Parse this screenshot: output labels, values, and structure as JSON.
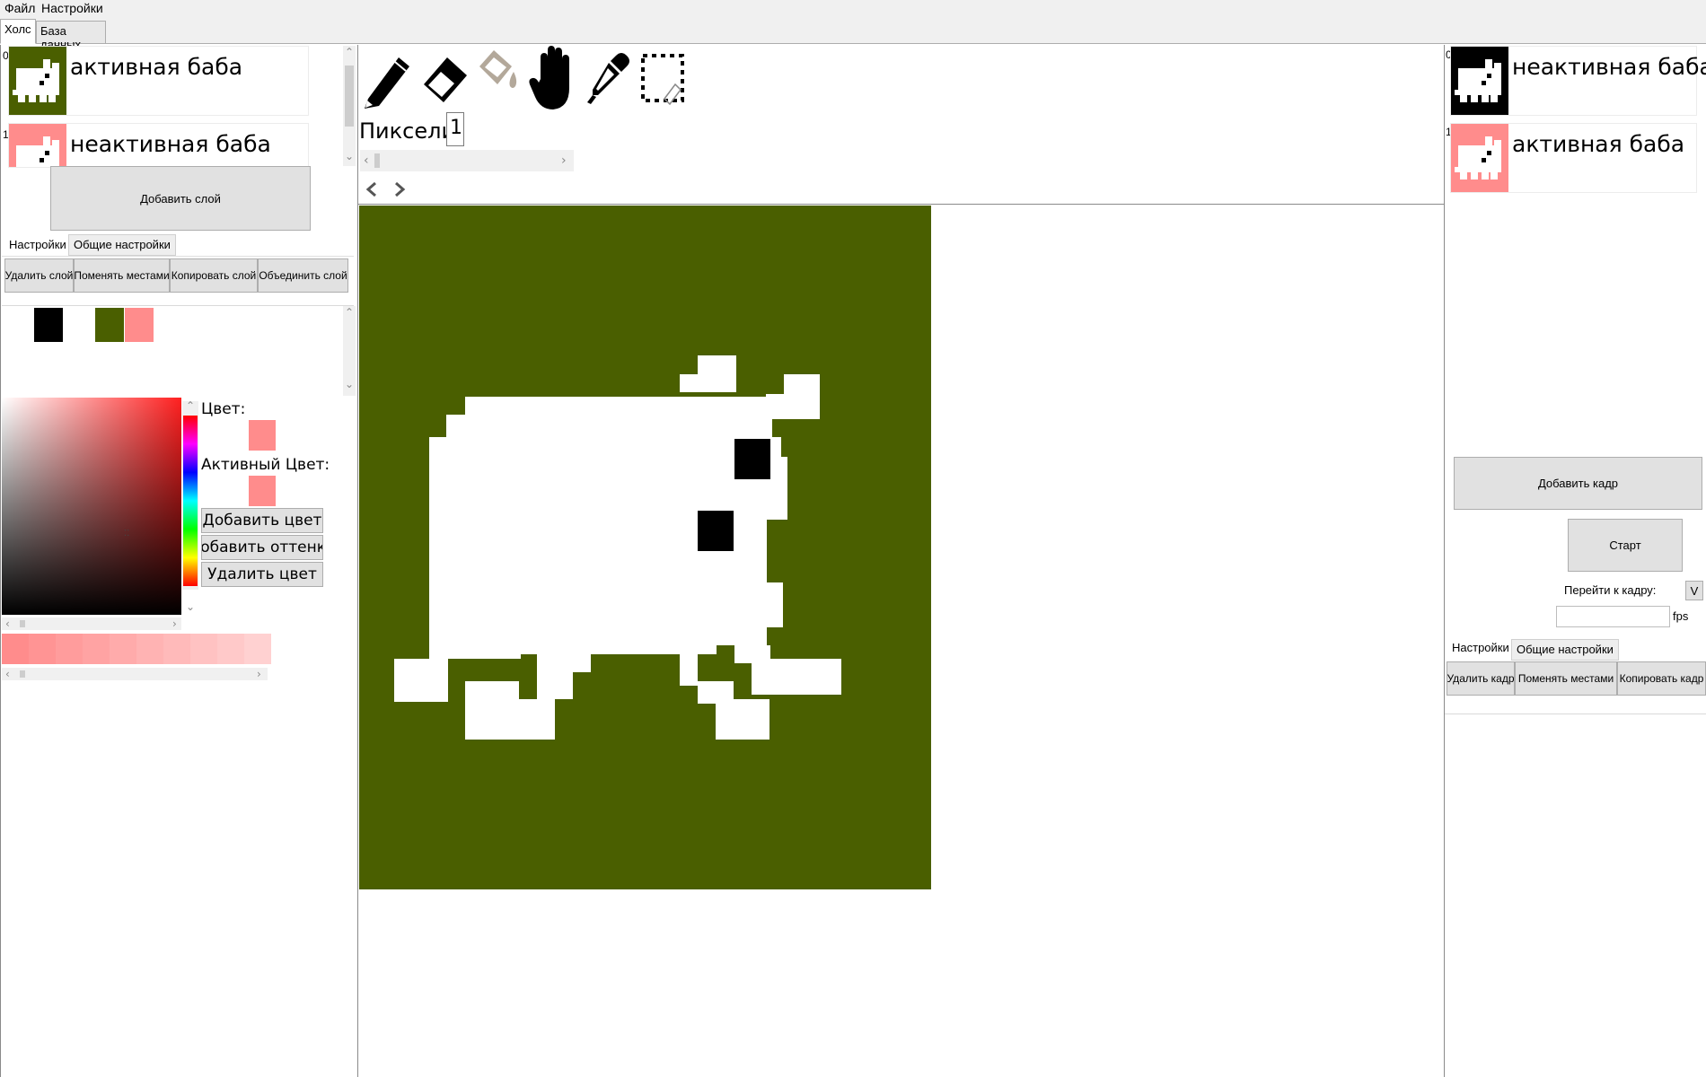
{
  "menu": {
    "file": "Файл",
    "settings": "Настройки"
  },
  "main_tabs": {
    "canvas": "Холс",
    "database": "База данных"
  },
  "layers": {
    "items": [
      {
        "index": "0",
        "label": "активная баба",
        "bg": "#4a5f00"
      },
      {
        "index": "1",
        "label": "неактивная баба",
        "bg": "#ff8c8c"
      }
    ],
    "add_button": "Добавить слой",
    "tabs": {
      "settings": "Настройки",
      "general": "Общие настройки"
    },
    "actions": {
      "delete": "Удалить слой",
      "swap": "Поменять местами",
      "copy": "Копировать слой",
      "merge": "Объединить слой"
    }
  },
  "palette": {
    "colors": [
      "#000000",
      "#ffffff",
      "#4a5f00",
      "#ff8c8c"
    ]
  },
  "color_picker": {
    "color_label": "Цвет:",
    "color_value": "#ff8c8c",
    "active_label": "Активный Цвет:",
    "active_value": "#ff8c8c",
    "add_color": "Добавить цвет",
    "add_shades": "Добавить оттенки",
    "delete_color": "Удалить цвет",
    "shades": [
      "#ff8c8c",
      "#ff9494",
      "#ff9c9c",
      "#ffa3a3",
      "#ffabab",
      "#ffb3b3",
      "#ffbaba",
      "#ffc2c2",
      "#ffc9c9",
      "#ffd1d1"
    ]
  },
  "toolbar": {
    "tools": [
      "pencil-icon",
      "eraser-icon",
      "fill-bucket-icon",
      "hand-icon",
      "eyedropper-icon",
      "selection-icon"
    ],
    "pixels_label": "Пиксели:",
    "pixels_value": "1"
  },
  "canvas": {
    "background": "#4a5f00",
    "foreground": "#ffffff",
    "accent": "#000000"
  },
  "frames": {
    "items": [
      {
        "index": "0",
        "label": "неактивная баба",
        "bg": "#000000"
      },
      {
        "index": "1",
        "label": "активная баба",
        "bg": "#ff8c8c"
      }
    ],
    "add_frame": "Добавить кадр",
    "start": "Старт",
    "goto_label": "Перейти к кадру:",
    "goto_button": "V",
    "fps_value": "",
    "fps_unit": "fps",
    "tabs": {
      "settings": "Настройки",
      "general": "Общие настройки"
    },
    "actions": {
      "delete": "Удалить кадр",
      "swap": "Поменять местами",
      "copy": "Копировать кадр"
    }
  }
}
